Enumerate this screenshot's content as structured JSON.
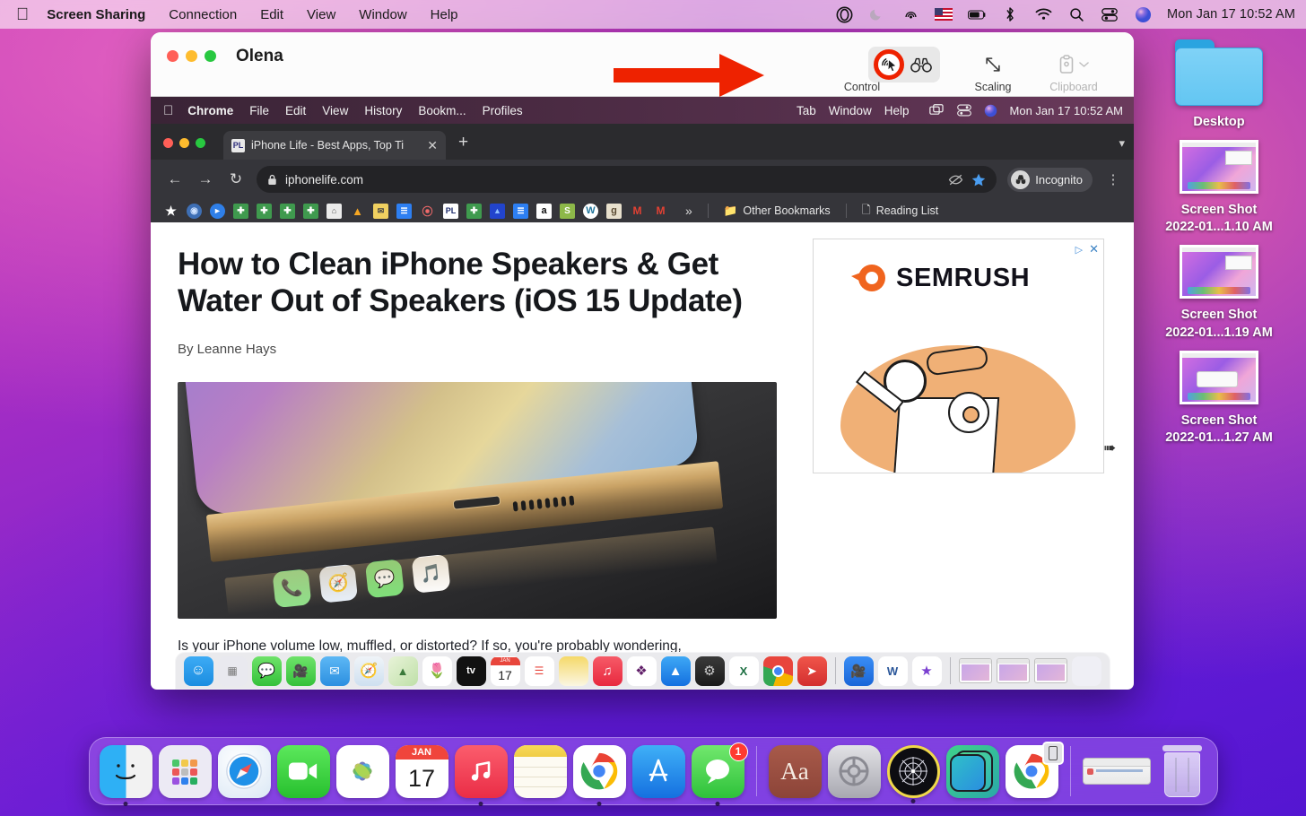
{
  "menubar": {
    "apple_icon": "apple-logo",
    "app_name": "Screen Sharing",
    "items": [
      "Connection",
      "Edit",
      "View",
      "Window",
      "Help"
    ],
    "status_icons": [
      "record-target-icon",
      "do-not-disturb-moon-icon",
      "airplay-icon",
      "us-flag-icon",
      "battery-icon",
      "bluetooth-icon",
      "wifi-icon",
      "search-icon",
      "control-center-icon",
      "siri-icon"
    ],
    "datetime": "Mon Jan 17  10:52 AM"
  },
  "desktop": {
    "folder": {
      "label": "Desktop",
      "icon": "blue-folder-icon"
    },
    "files": [
      {
        "label_line1": "Screen Shot",
        "label_line2": "2022-01...1.10 AM"
      },
      {
        "label_line1": "Screen Shot",
        "label_line2": "2022-01...1.19 AM"
      },
      {
        "label_line1": "Screen Shot",
        "label_line2": "2022-01...1.27 AM"
      }
    ]
  },
  "screen_sharing_window": {
    "title": "Olena",
    "traffic_lights": [
      "close-red",
      "minimize-yellow",
      "maximize-green"
    ],
    "toolbar": [
      {
        "label": "Control",
        "icon": "cursor-control-icon",
        "highlighted": true,
        "enabled": true
      },
      {
        "label": "",
        "icon": "binoculars-observe-icon",
        "highlighted": false,
        "enabled": true
      },
      {
        "label": "Scaling",
        "icon": "scaling-arrows-icon",
        "highlighted": false,
        "enabled": true
      },
      {
        "label": "Clipboard",
        "icon": "clipboard-icon",
        "highlighted": false,
        "enabled": false
      }
    ],
    "annotation": {
      "type": "red-arrow-pointing-right",
      "target": "Control",
      "color": "#ee2200"
    }
  },
  "remote_screen": {
    "menubar": {
      "apple_icon": "apple-logo",
      "app_name": "Chrome",
      "items": [
        "File",
        "Edit",
        "View",
        "History",
        "Bookm...",
        "Profiles"
      ],
      "right_items": [
        "Tab",
        "Window",
        "Help"
      ],
      "status_icons": [
        "screen-mirroring-icon",
        "control-center-icon",
        "siri-icon"
      ],
      "datetime": "Mon Jan 17 10:52 AM"
    },
    "browser": {
      "tab": {
        "favicon": "PL",
        "title": "iPhone Life - Best Apps, Top Ti",
        "close_icon": "close-x-icon"
      },
      "new_tab_icon": "plus-icon",
      "tab_list_chevron": "chevron-down-icon",
      "nav": {
        "back_icon": "arrow-left-icon",
        "forward_icon": "arrow-right-icon",
        "reload_icon": "reload-icon"
      },
      "omnibox": {
        "lock_icon": "lock-icon",
        "url": "iphonelife.com",
        "eye_off_icon": "eye-slash-icon",
        "bookmark_star_icon": "star-filled-icon"
      },
      "profile": {
        "label": "Incognito",
        "icon": "incognito-hat-icon"
      },
      "menu_icon": "three-dot-menu-icon",
      "bookmarks": {
        "items": [
          {
            "icon": "star-icon",
            "color": "#f2f2f2"
          },
          {
            "icon": "globe-icon",
            "color": "#4a7fc1"
          },
          {
            "icon": "video-icon",
            "color": "#2f7fe8"
          },
          {
            "icon": "cross-green-icon",
            "color": "#3f9a4e"
          },
          {
            "icon": "cross-green-icon",
            "color": "#3f9a4e"
          },
          {
            "icon": "cross-green-icon",
            "color": "#3f9a4e"
          },
          {
            "icon": "cross-green-icon",
            "color": "#3f9a4e"
          },
          {
            "icon": "store-icon",
            "color": "#e8e8e8"
          },
          {
            "icon": "analytics-bars-icon",
            "color": "#f5a623"
          },
          {
            "icon": "mail-envelope-icon",
            "color": "#f0d060"
          },
          {
            "icon": "docs-icon",
            "color": "#2d7ff2"
          },
          {
            "icon": "asana-dots-icon",
            "color": "#f06a6a"
          },
          {
            "icon": "pl-logo-icon",
            "color": "#ffffff"
          },
          {
            "icon": "cross-green-icon",
            "color": "#3f9a4e"
          },
          {
            "icon": "analytics-blue-icon",
            "color": "#2244cc"
          },
          {
            "icon": "docs-icon",
            "color": "#2d7ff2"
          },
          {
            "icon": "amazon-icon",
            "color": "#ffffff"
          },
          {
            "icon": "shopify-icon",
            "color": "#8db849"
          },
          {
            "icon": "wordpress-icon",
            "color": "#ffffff"
          },
          {
            "icon": "goodreads-icon",
            "color": "#e8e0cd"
          },
          {
            "icon": "gmail-icon",
            "color": "#ffffff"
          },
          {
            "icon": "gmail-icon",
            "color": "#ffffff"
          }
        ],
        "overflow_icon": "double-chevron-icon",
        "other_bookmarks": {
          "label": "Other Bookmarks",
          "icon": "folder-icon"
        },
        "reading_list": {
          "label": "Reading List",
          "icon": "reading-list-icon"
        }
      },
      "page": {
        "headline": "How to Clean iPhone Speakers & Get Water Out of Speakers (iOS 15 Update)",
        "byline": "By Leanne Hays",
        "hero_image_alt": "gold-iphone-bottom-edge-photo",
        "body_text": "Is your iPhone volume low, muffled, or distorted? If so, you're probably wondering,",
        "ad": {
          "brand": "SEMRUSH",
          "logo_icon": "semrush-comet-icon",
          "adchoices_icon": "adchoices-icon",
          "close_icon": "close-x-icon",
          "illustration_alt": "robot-arm-with-magnifier-and-gear"
        }
      }
    },
    "dock_items": [
      "finder-icon",
      "launchpad-icon",
      "messages-icon",
      "facetime-icon",
      "mail-icon",
      "safari-icon",
      "maps-icon",
      "photos-icon",
      "appletv-icon",
      "calendar-icon",
      "reminders-icon",
      "notes-icon",
      "music-icon",
      "slack-icon",
      "appstore-icon",
      "system-preferences-icon",
      "excel-icon",
      "chrome-icon",
      "sendinblue-icon",
      "zoom-icon",
      "word-icon",
      "imovie-icon"
    ],
    "dock_calendar": {
      "month": "JAN",
      "day": "17"
    }
  },
  "host_dock": {
    "items": [
      {
        "name": "finder-icon",
        "running": true
      },
      {
        "name": "launchpad-icon",
        "running": false
      },
      {
        "name": "safari-icon",
        "running": false
      },
      {
        "name": "facetime-icon",
        "running": false
      },
      {
        "name": "photos-icon",
        "running": false
      },
      {
        "name": "calendar-icon",
        "running": false
      },
      {
        "name": "music-icon",
        "running": true
      },
      {
        "name": "notes-icon",
        "running": false
      },
      {
        "name": "chrome-icon",
        "running": true
      },
      {
        "name": "appstore-icon",
        "running": false
      },
      {
        "name": "messages-icon",
        "running": true,
        "badge": "1"
      }
    ],
    "items2": [
      {
        "name": "dictionary-icon",
        "label": "Aa",
        "running": false
      },
      {
        "name": "system-preferences-icon",
        "running": false
      },
      {
        "name": "screen-sharing-icon",
        "running": true
      },
      {
        "name": "sim-toolkit-icon",
        "running": false
      },
      {
        "name": "chrome-mobile-icon",
        "running": false
      }
    ],
    "minimized_window": "minimized-window-thumbnail",
    "trash": "trash-icon",
    "calendar": {
      "month": "JAN",
      "day": "17"
    }
  }
}
